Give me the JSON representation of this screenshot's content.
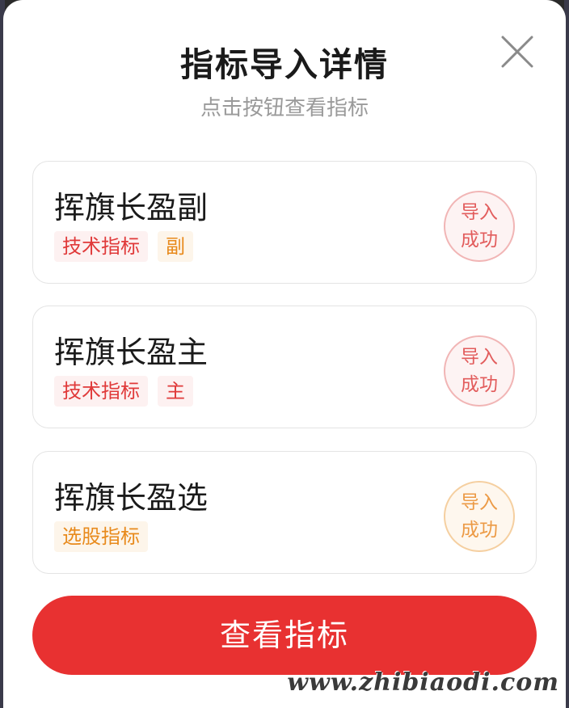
{
  "dialog": {
    "title": "指标导入详情",
    "subtitle": "点击按钮查看指标",
    "close_icon": "close-icon"
  },
  "cards": [
    {
      "name": "挥旗长盈副",
      "tags": [
        {
          "label": "技术指标",
          "color": "red"
        },
        {
          "label": "副",
          "color": "orange"
        }
      ],
      "status_line1": "导入",
      "status_line2": "成功",
      "status_color": "red"
    },
    {
      "name": "挥旗长盈主",
      "tags": [
        {
          "label": "技术指标",
          "color": "red"
        },
        {
          "label": "主",
          "color": "red"
        }
      ],
      "status_line1": "导入",
      "status_line2": "成功",
      "status_color": "red"
    },
    {
      "name": "挥旗长盈选",
      "tags": [
        {
          "label": "选股指标",
          "color": "orange"
        }
      ],
      "status_line1": "导入",
      "status_line2": "成功",
      "status_color": "orange"
    }
  ],
  "actions": {
    "view_label": "查看指标"
  },
  "watermark": "www.zhibiaodi.com",
  "colors": {
    "accent": "#e83131",
    "tag_red": "#e03a3a",
    "tag_orange": "#e88a1c"
  }
}
